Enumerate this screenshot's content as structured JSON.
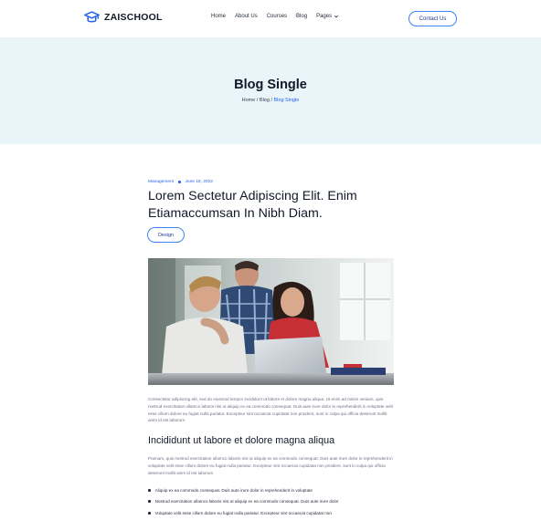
{
  "header": {
    "brand": "ZAISCHOOL",
    "nav": [
      {
        "label": "Home"
      },
      {
        "label": "About Us"
      },
      {
        "label": "Courses"
      },
      {
        "label": "Blog"
      },
      {
        "label": "Pages"
      }
    ],
    "contact_label": "Contact Us"
  },
  "hero": {
    "title": "Blog Single",
    "breadcrumb": {
      "home": "Home",
      "sep1": " / ",
      "blog": "Blog",
      "sep2": " / ",
      "current": "Blog Single"
    }
  },
  "article": {
    "category": "Management",
    "date": "June 18, 2022",
    "title": "Lorem Sectetur Adipiscing Elit. Enim Etiamaccumsan In Nibh Diam.",
    "tag": "Design",
    "paragraph1": "Consectetur adipiscing elit, sed do eiusmod tempor incididunt ut labore et dolore magna aliqua. Ut enim ad minim veniam, quis nostrud exercitation ullamco laboris nisi ut aliquip ex ea commodo consequat. Duis aute irure dolor in reprehenderit in voluptate velit esse cillum dolore eu fugiat nulla pariatur. Excepteur sint occaecat cupidatat non proident, sunt in culpa qui officia deserunt mollit anim id est laborum",
    "subheading": "Incididunt ut labore et dolore magna aliqua",
    "paragraph2": "Poenam, quis nostrud exercitation ullamco laboris nisi ut aliquip ex ea commodo consequat. Duis aute irure dolor in reprehenderit in voluptate velit esse cillum dolore eu fugiat nulla pariatur. Excepteur sint occaecat cupidatat non proident, sunt in culpa qui officia deserunt mollit anim id est laborum",
    "bullets": [
      "Aliquip ex ea commodo consequat. Duis aute irure dolor in reprehenderit in voluptate",
      "Nostrud exercitation ullamco laboris nisi ut aliquip ex ea commodo consequat. Duis aute irure dolor",
      "Voluptate velit esse cillum dolore eu fugiat nulla pariatur. Excepteur sint occaecat cupidatat non"
    ]
  },
  "colors": {
    "accent": "#2563eb",
    "hero_bg": "#eaf5fa",
    "text": "#111827"
  },
  "icons": {
    "logo": "graduation-cap-icon",
    "pages_menu": "chevron-down-icon"
  }
}
